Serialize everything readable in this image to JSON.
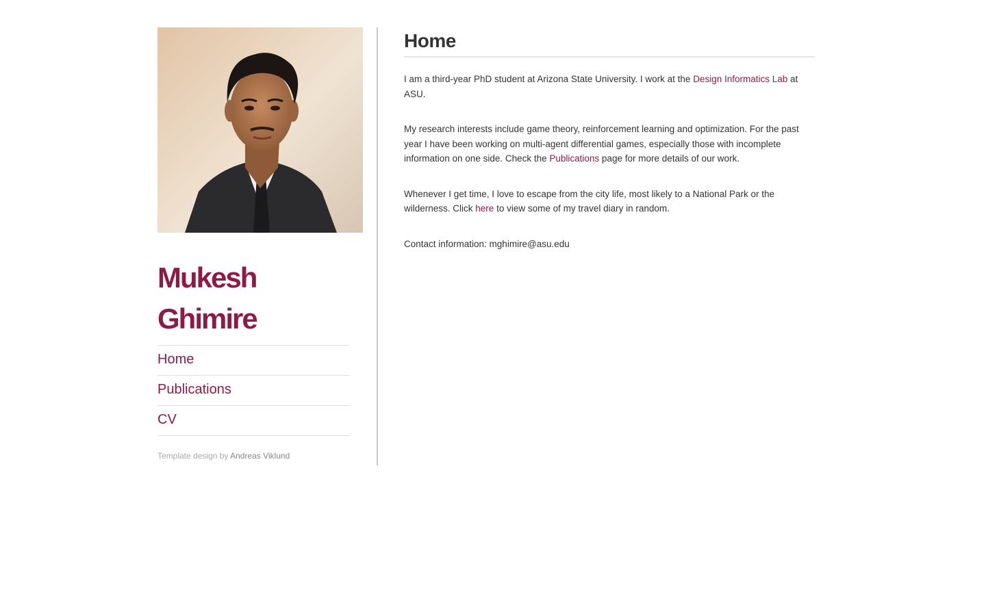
{
  "sidebar": {
    "photo_alt": "Portrait photo",
    "name_line1": "Mukesh",
    "name_line2": "Ghimire",
    "nav": [
      {
        "label": "Home"
      },
      {
        "label": "Publications"
      },
      {
        "label": "CV"
      }
    ],
    "credit_prefix": "Template design by ",
    "credit_link": "Andreas Viklund"
  },
  "main": {
    "title": "Home",
    "p1_text": "I am a third-year PhD student at Arizona State University. I work at the ",
    "p1_link": "Design Informatics Lab",
    "p1_end": " at ASU.",
    "p2_text": "My research interests include game theory, reinforcement learning and optimization. For the past year I have been working on multi-agent differential games, especially those with incomplete information on one side. Check the ",
    "p2_link": "Publications",
    "p2_end": " page for more details of our work.",
    "p3_text": "Whenever I get time, I love to escape from the city life, most likely to a National Park or the wilderness. Click ",
    "p3_link": "here",
    "p3_end": " to view some of my travel diary in random.",
    "p4_text": "Contact information: mghimire@asu.edu"
  },
  "colors": {
    "accent": "#8c1c47",
    "text": "#333333",
    "divider": "#c8c8c8"
  }
}
